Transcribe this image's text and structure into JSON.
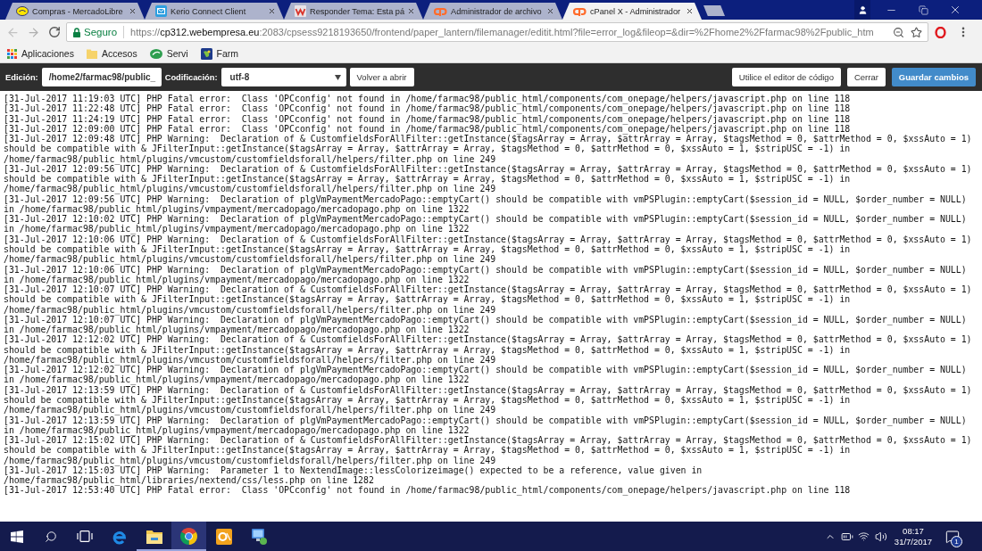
{
  "browser": {
    "tabs": [
      {
        "kind": "shop",
        "title": "Compras - MercadoLibre",
        "selected": false
      },
      {
        "kind": "mail",
        "title": "Kerio Connect Client",
        "selected": false
      },
      {
        "kind": "forum",
        "title": "Responder Tema: Esta pá",
        "selected": false
      },
      {
        "kind": "cpanel",
        "title": "Administrador de archivo",
        "selected": false
      },
      {
        "kind": "cpanel",
        "title": "cPanel X - Administrador",
        "selected": true
      }
    ],
    "address_bar": {
      "security_label": "Seguro",
      "url_scheme": "https://",
      "url_host": "cp312.webempresa.eu",
      "url_rest": ":2083/cpsess9218193650/frontend/paper_lantern/filemanager/editit.html?file=error_log&fileop=&dir=%2Fhome2%2Ffarmac98%2Fpublic_htm"
    },
    "bookmarks": [
      {
        "kind": "apps",
        "label": "Aplicaciones"
      },
      {
        "kind": "folder",
        "label": "Accesos"
      },
      {
        "kind": "green",
        "label": "Servi"
      },
      {
        "kind": "blue",
        "label": "Farm"
      }
    ]
  },
  "editor_toolbar": {
    "path_label": "Edición:",
    "path_value": "/home2/farmac98/public_",
    "encoding_label": "Codificación:",
    "encoding_value": "utf-8",
    "reopen_button": "Volver a abrir",
    "code_editor_button": "Utilice el editor de código",
    "close_button": "Cerrar",
    "save_button": "Guardar cambios"
  },
  "editor": {
    "lines": [
      "[31-Jul-2017 11:19:03 UTC] PHP Fatal error:  Class 'OPCconfig' not found in /home/farmac98/public_html/components/com_onepage/helpers/javascript.php on line 118",
      "[31-Jul-2017 11:22:48 UTC] PHP Fatal error:  Class 'OPCconfig' not found in /home/farmac98/public_html/components/com_onepage/helpers/javascript.php on line 118",
      "[31-Jul-2017 11:24:19 UTC] PHP Fatal error:  Class 'OPCconfig' not found in /home/farmac98/public_html/components/com_onepage/helpers/javascript.php on line 118",
      "[31-Jul-2017 12:09:00 UTC] PHP Fatal error:  Class 'OPCconfig' not found in /home/farmac98/public_html/components/com_onepage/helpers/javascript.php on line 118",
      "[31-Jul-2017 12:09:48 UTC] PHP Warning:  Declaration of & CustomfieldsForAllFilter::getInstance($tagsArray = Array, $attrArray = Array, $tagsMethod = 0, $attrMethod = 0, $xssAuto = 1)",
      "should be compatible with & JFilterInput::getInstance($tagsArray = Array, $attrArray = Array, $tagsMethod = 0, $attrMethod = 0, $xssAuto = 1, $stripUSC = -1) in",
      "/home/farmac98/public_html/plugins/vmcustom/customfieldsforall/helpers/filter.php on line 249",
      "[31-Jul-2017 12:09:56 UTC] PHP Warning:  Declaration of & CustomfieldsForAllFilter::getInstance($tagsArray = Array, $attrArray = Array, $tagsMethod = 0, $attrMethod = 0, $xssAuto = 1)",
      "should be compatible with & JFilterInput::getInstance($tagsArray = Array, $attrArray = Array, $tagsMethod = 0, $attrMethod = 0, $xssAuto = 1, $stripUSC = -1) in",
      "/home/farmac98/public_html/plugins/vmcustom/customfieldsforall/helpers/filter.php on line 249",
      "[31-Jul-2017 12:09:56 UTC] PHP Warning:  Declaration of plgVmPaymentMercadoPago::emptyCart() should be compatible with vmPSPlugin::emptyCart($session_id = NULL, $order_number = NULL)",
      "in /home/farmac98/public_html/plugins/vmpayment/mercadopago/mercadopago.php on line 1322",
      "[31-Jul-2017 12:10:02 UTC] PHP Warning:  Declaration of plgVmPaymentMercadoPago::emptyCart() should be compatible with vmPSPlugin::emptyCart($session_id = NULL, $order_number = NULL)",
      "in /home/farmac98/public_html/plugins/vmpayment/mercadopago/mercadopago.php on line 1322",
      "[31-Jul-2017 12:10:06 UTC] PHP Warning:  Declaration of & CustomfieldsForAllFilter::getInstance($tagsArray = Array, $attrArray = Array, $tagsMethod = 0, $attrMethod = 0, $xssAuto = 1)",
      "should be compatible with & JFilterInput::getInstance($tagsArray = Array, $attrArray = Array, $tagsMethod = 0, $attrMethod = 0, $xssAuto = 1, $stripUSC = -1) in",
      "/home/farmac98/public_html/plugins/vmcustom/customfieldsforall/helpers/filter.php on line 249",
      "[31-Jul-2017 12:10:06 UTC] PHP Warning:  Declaration of plgVmPaymentMercadoPago::emptyCart() should be compatible with vmPSPlugin::emptyCart($session_id = NULL, $order_number = NULL)",
      "in /home/farmac98/public_html/plugins/vmpayment/mercadopago/mercadopago.php on line 1322",
      "[31-Jul-2017 12:10:07 UTC] PHP Warning:  Declaration of & CustomfieldsForAllFilter::getInstance($tagsArray = Array, $attrArray = Array, $tagsMethod = 0, $attrMethod = 0, $xssAuto = 1)",
      "should be compatible with & JFilterInput::getInstance($tagsArray = Array, $attrArray = Array, $tagsMethod = 0, $attrMethod = 0, $xssAuto = 1, $stripUSC = -1) in",
      "/home/farmac98/public_html/plugins/vmcustom/customfieldsforall/helpers/filter.php on line 249",
      "[31-Jul-2017 12:10:07 UTC] PHP Warning:  Declaration of plgVmPaymentMercadoPago::emptyCart() should be compatible with vmPSPlugin::emptyCart($session_id = NULL, $order_number = NULL)",
      "in /home/farmac98/public_html/plugins/vmpayment/mercadopago/mercadopago.php on line 1322",
      "[31-Jul-2017 12:12:02 UTC] PHP Warning:  Declaration of & CustomfieldsForAllFilter::getInstance($tagsArray = Array, $attrArray = Array, $tagsMethod = 0, $attrMethod = 0, $xssAuto = 1)",
      "should be compatible with & JFilterInput::getInstance($tagsArray = Array, $attrArray = Array, $tagsMethod = 0, $attrMethod = 0, $xssAuto = 1, $stripUSC = -1) in",
      "/home/farmac98/public_html/plugins/vmcustom/customfieldsforall/helpers/filter.php on line 249",
      "[31-Jul-2017 12:12:02 UTC] PHP Warning:  Declaration of plgVmPaymentMercadoPago::emptyCart() should be compatible with vmPSPlugin::emptyCart($session_id = NULL, $order_number = NULL)",
      "in /home/farmac98/public_html/plugins/vmpayment/mercadopago/mercadopago.php on line 1322",
      "[31-Jul-2017 12:13:59 UTC] PHP Warning:  Declaration of & CustomfieldsForAllFilter::getInstance($tagsArray = Array, $attrArray = Array, $tagsMethod = 0, $attrMethod = 0, $xssAuto = 1)",
      "should be compatible with & JFilterInput::getInstance($tagsArray = Array, $attrArray = Array, $tagsMethod = 0, $attrMethod = 0, $xssAuto = 1, $stripUSC = -1) in",
      "/home/farmac98/public_html/plugins/vmcustom/customfieldsforall/helpers/filter.php on line 249",
      "[31-Jul-2017 12:13:59 UTC] PHP Warning:  Declaration of plgVmPaymentMercadoPago::emptyCart() should be compatible with vmPSPlugin::emptyCart($session_id = NULL, $order_number = NULL)",
      "in /home/farmac98/public_html/plugins/vmpayment/mercadopago/mercadopago.php on line 1322",
      "[31-Jul-2017 12:15:02 UTC] PHP Warning:  Declaration of & CustomfieldsForAllFilter::getInstance($tagsArray = Array, $attrArray = Array, $tagsMethod = 0, $attrMethod = 0, $xssAuto = 1)",
      "should be compatible with & JFilterInput::getInstance($tagsArray = Array, $attrArray = Array, $tagsMethod = 0, $attrMethod = 0, $xssAuto = 1, $stripUSC = -1) in",
      "/home/farmac98/public_html/plugins/vmcustom/customfieldsforall/helpers/filter.php on line 249",
      "[31-Jul-2017 12:15:03 UTC] PHP Warning:  Parameter 1 to NextendImage::lessColorizeimage() expected to be a reference, value given in",
      "/home/farmac98/public_html/libraries/nextend/css/less.php on line 1282",
      "[31-Jul-2017 12:53:40 UTC] PHP Fatal error:  Class 'OPCconfig' not found in /home/farmac98/public_html/components/com_onepage/helpers/javascript.php on line 118"
    ]
  },
  "taskbar": {
    "apps": [
      {
        "kind": "edge",
        "open": false,
        "selected": false
      },
      {
        "kind": "files",
        "open": true,
        "selected": false
      },
      {
        "kind": "chrome",
        "open": true,
        "selected": true
      },
      {
        "kind": "mail",
        "open": false,
        "selected": false
      },
      {
        "kind": "remote",
        "open": false,
        "selected": false
      }
    ],
    "time": "08:17",
    "date": "31/7/2017",
    "notification_count": "1"
  }
}
